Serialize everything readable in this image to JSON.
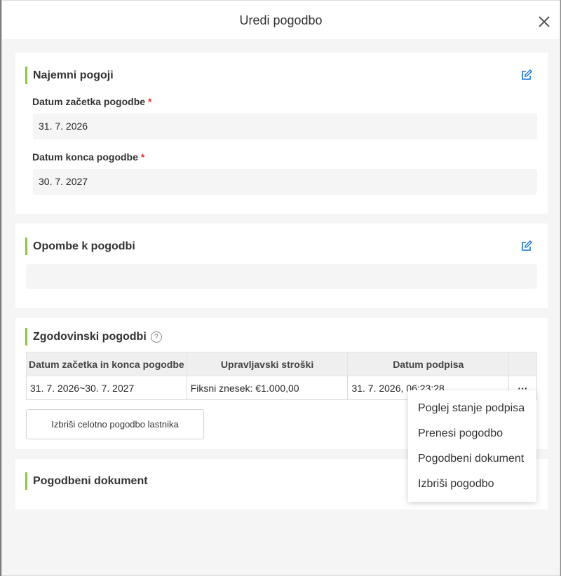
{
  "modal": {
    "title": "Uredi pogodbo"
  },
  "lease_terms": {
    "title": "Najemni pogoji",
    "start_label": "Datum začetka pogodbe",
    "start_value": "31. 7. 2026",
    "end_label": "Datum konca pogodbe",
    "end_value": "30. 7. 2027",
    "required_mark": "*"
  },
  "notes": {
    "title": "Opombe k pogodbi",
    "value": ""
  },
  "history": {
    "title": "Zgodovinski pogodbi",
    "help": "?",
    "columns": [
      "Datum začetka in konca pogodbe",
      "Upravljavski stroški",
      "Datum podpisa"
    ],
    "rows": [
      {
        "period": "31. 7. 2026~30. 7. 2027",
        "costs": "Fiksni znesek: €1.000,00",
        "signed": "31. 7. 2026, 06:23:28",
        "more": "···"
      }
    ],
    "delete_owner_button": "Izbriši celotno pogodbo lastnika"
  },
  "document": {
    "title": "Pogodbeni dokument"
  },
  "row_menu": {
    "items": [
      "Poglej stanje podpisa",
      "Prenesi pogodbo",
      "Pogodbeni dokument",
      "Izbriši pogodbo"
    ]
  },
  "colors": {
    "accent_bar": "#8dc641",
    "edit_icon": "#1677d2",
    "required": "#e5302b"
  }
}
